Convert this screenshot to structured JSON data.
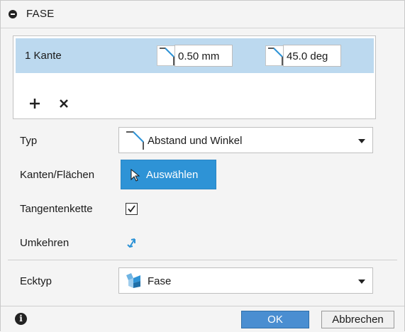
{
  "title": "FASE",
  "selection": {
    "row_label": "1 Kante",
    "distance_value": "0.50 mm",
    "angle_value": "45.0 deg"
  },
  "fields": {
    "type_label": "Typ",
    "type_value": "Abstand und Winkel",
    "edges_label": "Kanten/Flächen",
    "select_button": "Auswählen",
    "tangent_label": "Tangentenkette",
    "tangent_checked": true,
    "flip_label": "Umkehren",
    "corner_label": "Ecktyp",
    "corner_value": "Fase"
  },
  "buttons": {
    "ok": "OK",
    "cancel": "Abbrechen"
  },
  "colors": {
    "selected_row": "#bcd9ef",
    "accent_blue": "#2e93d6"
  }
}
